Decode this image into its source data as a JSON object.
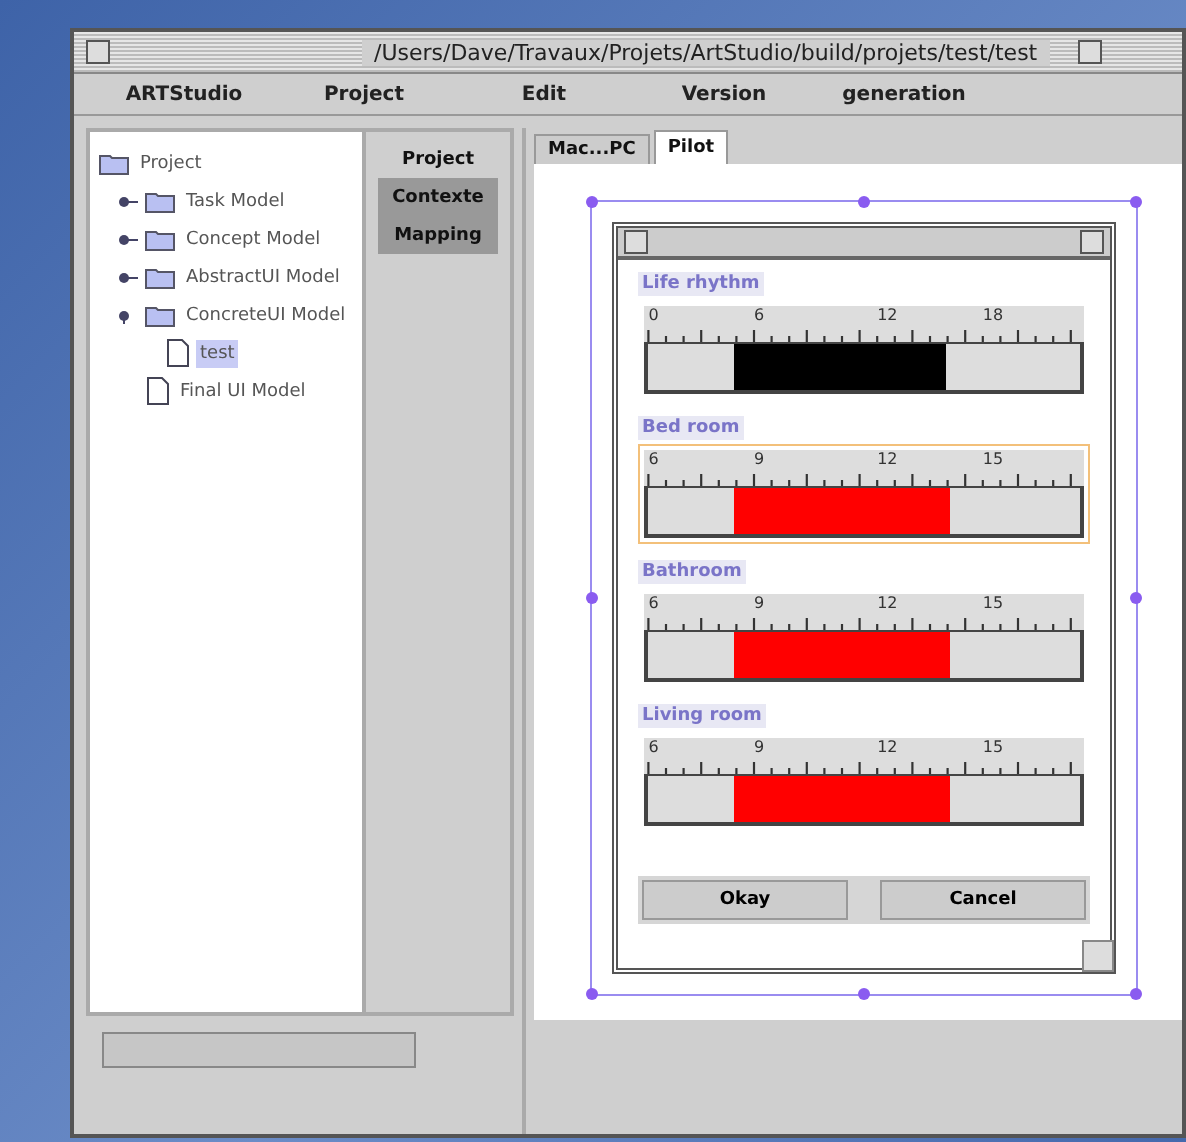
{
  "window": {
    "title": "/Users/Dave/Travaux/Projets/ArtStudio/build/projets/test/test"
  },
  "menu": [
    "ARTStudio",
    "Project",
    "Edit",
    "Version",
    "generation"
  ],
  "tree": [
    {
      "label": "Project",
      "kind": "folder",
      "children": [
        {
          "label": "Task Model",
          "kind": "folder",
          "expanded": false
        },
        {
          "label": "Concept Model",
          "kind": "folder",
          "expanded": false
        },
        {
          "label": "AbstractUI Model",
          "kind": "folder",
          "expanded": false
        },
        {
          "label": "ConcreteUI Model",
          "kind": "folder",
          "expanded": true,
          "children": [
            {
              "label": "test",
              "kind": "file",
              "selected": true
            }
          ]
        },
        {
          "label": "Final UI Model",
          "kind": "file",
          "selected": false
        }
      ]
    }
  ],
  "side_buttons": [
    {
      "label": "Project",
      "selected": false
    },
    {
      "label": "Contexte",
      "selected": true
    },
    {
      "label": "Mapping",
      "selected": true
    }
  ],
  "tabs": [
    {
      "label": "Mac...PC",
      "selected": false
    },
    {
      "label": "Pilot",
      "selected": true
    }
  ],
  "dialog": {
    "sliders": [
      {
        "label": "Life rhythm",
        "ticks": [
          "0",
          "6",
          "12",
          "18"
        ],
        "color": "#000000",
        "selected": false,
        "handles": [
          {
            "level": 0.2
          },
          {
            "level": 0.69
          }
        ]
      },
      {
        "label": "Bed room",
        "ticks": [
          "6",
          "9",
          "12",
          "15"
        ],
        "color": "#ff0000",
        "selected": true,
        "handles": [
          {
            "level": 0.2
          },
          {
            "level": 0.7
          }
        ]
      },
      {
        "label": "Bathroom",
        "ticks": [
          "6",
          "9",
          "12",
          "15"
        ],
        "color": "#ff0000",
        "selected": false,
        "handles": [
          {
            "level": 0.2
          },
          {
            "level": 0.7
          }
        ]
      },
      {
        "label": "Living room",
        "ticks": [
          "6",
          "9",
          "12",
          "15"
        ],
        "color": "#ff0000",
        "selected": false,
        "handles": [
          {
            "level": 0.2
          },
          {
            "level": 0.7
          }
        ]
      }
    ],
    "buttons": [
      "Okay",
      "Cancel"
    ]
  }
}
